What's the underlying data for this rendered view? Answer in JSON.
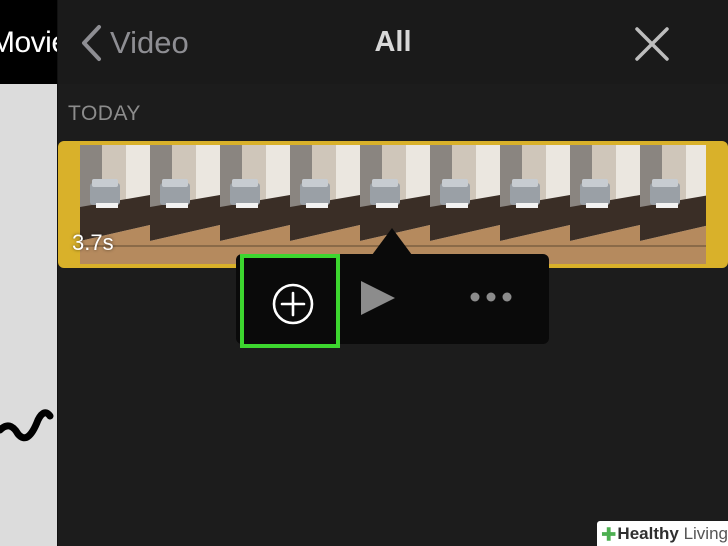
{
  "left_pane": {
    "title": "Movie"
  },
  "nav": {
    "back_label": "Video",
    "title": "All"
  },
  "section": {
    "header": "TODAY"
  },
  "clip": {
    "duration": "3.7s",
    "frame_count": 9
  },
  "popover": {
    "actions": [
      "add-icon",
      "play-icon",
      "more-icon"
    ],
    "highlight_color": "#3dd62f"
  },
  "watermark": {
    "brand": "Healthy",
    "brand_suffix": "Living"
  },
  "colors": {
    "clip_border": "#d9b12a",
    "background": "#1c1c1c",
    "highlight": "#3dd62f"
  }
}
